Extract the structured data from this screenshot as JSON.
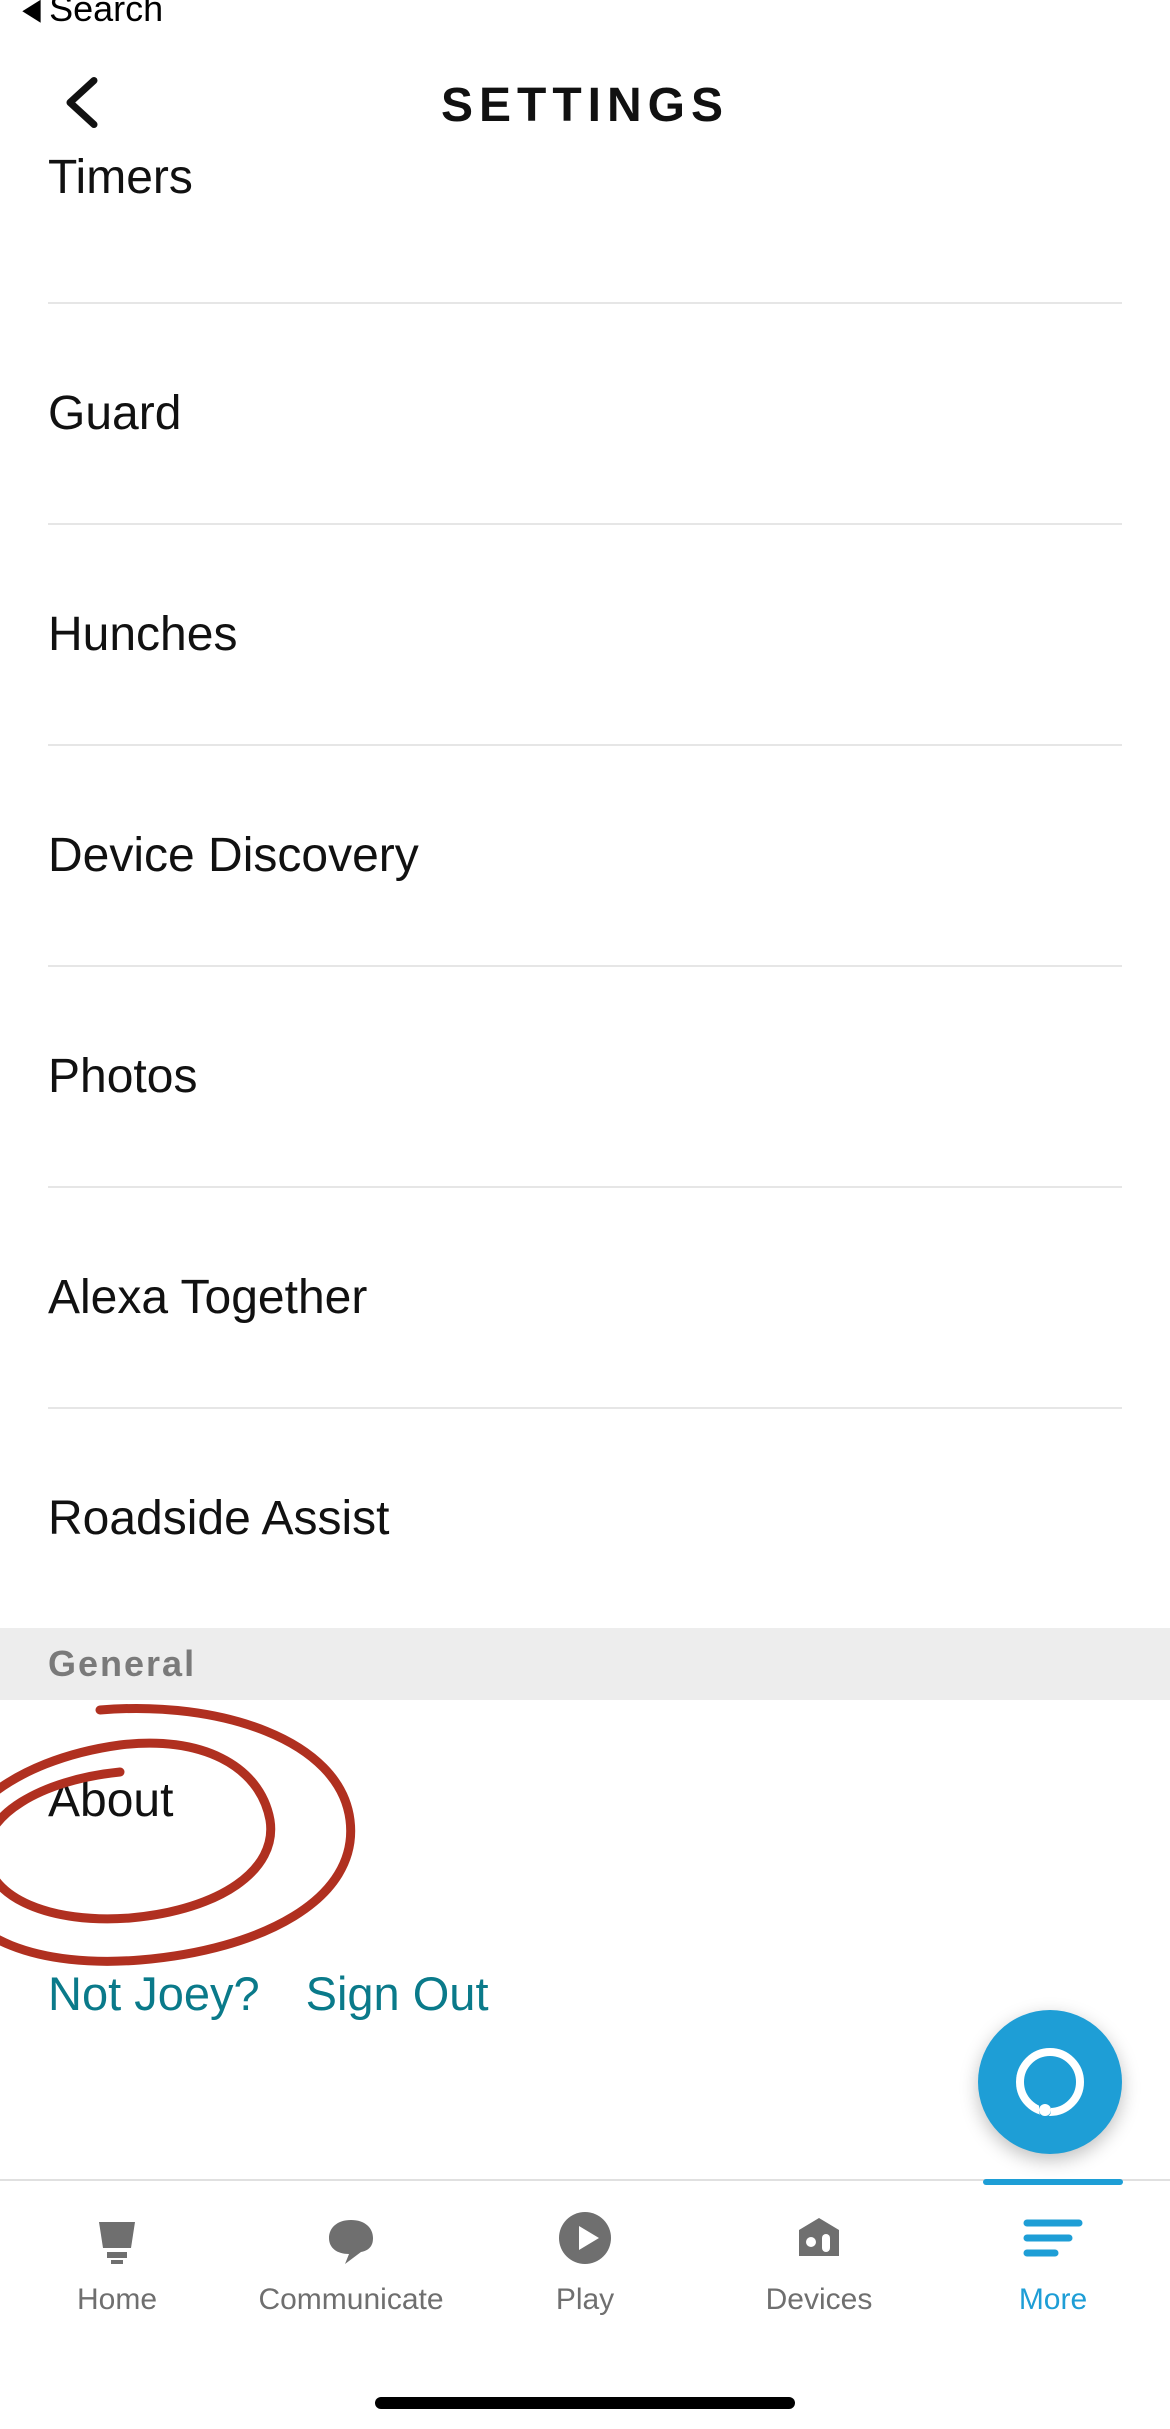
{
  "nav": {
    "back_to_search": "Search"
  },
  "header": {
    "title": "SETTINGS"
  },
  "items": {
    "timers": "Timers",
    "guard": "Guard",
    "hunches": "Hunches",
    "device_discovery": "Device Discovery",
    "photos": "Photos",
    "alexa_together": "Alexa Together",
    "roadside_assist": "Roadside Assist",
    "about": "About"
  },
  "section": {
    "general": "General"
  },
  "footer": {
    "not_user": "Not Joey?",
    "sign_out": "Sign Out"
  },
  "tabs": {
    "home": "Home",
    "communicate": "Communicate",
    "play": "Play",
    "devices": "Devices",
    "more": "More"
  },
  "colors": {
    "accent": "#1e9ed6",
    "link": "#0a7a8a"
  }
}
